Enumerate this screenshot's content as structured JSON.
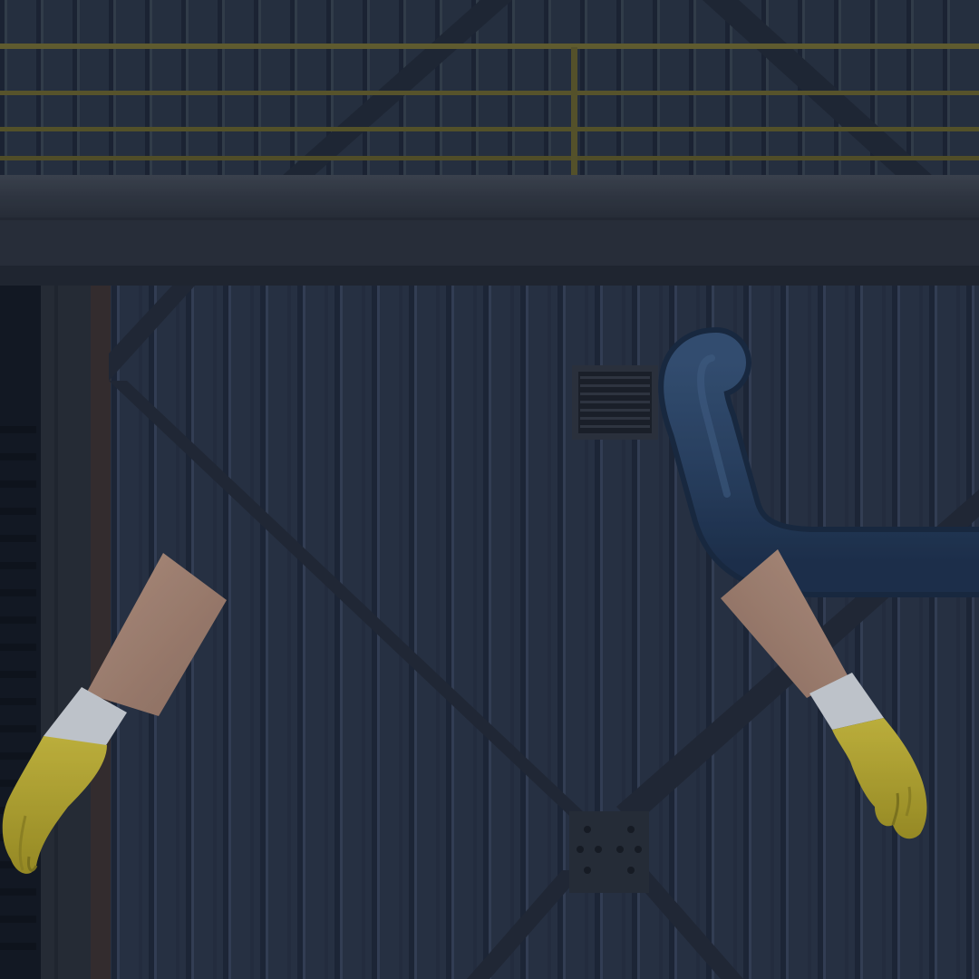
{
  "scene": {
    "description_free": true,
    "colors": {
      "wall": "#2b3547",
      "wall_dark": "#1f2839",
      "wall_light": "#3a4558",
      "beam": "#262d3b",
      "railing": "#6b6631",
      "ledge_top": "#3d434e",
      "ledge_bottom": "#2e343f",
      "pipe": "#2f4a6e",
      "pipe_shadow": "#233a58",
      "vent": "#222830",
      "skin": "#b4917e",
      "skin_shadow": "#9a7766",
      "glove": "#c9bb3a",
      "glove_shadow": "#a39626",
      "cuff": "#d8dde3",
      "plate": "#2a303b",
      "bolt": "#1a1f27"
    },
    "objects": [
      "upper-wall",
      "railing",
      "concrete-ledge",
      "corrugated-wall",
      "cross-brace",
      "vent-grille",
      "pipe",
      "left-arm",
      "right-arm",
      "brace-plate"
    ]
  }
}
